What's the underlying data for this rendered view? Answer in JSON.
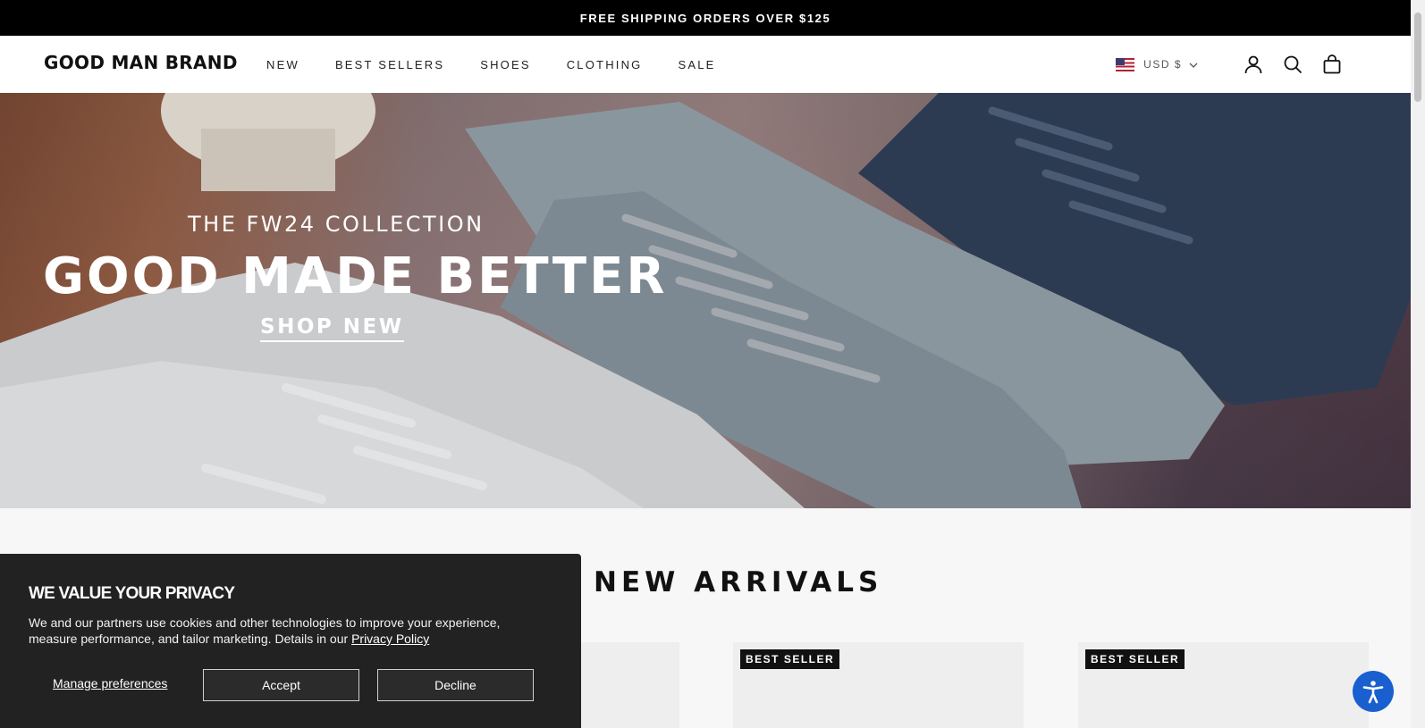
{
  "announcement": {
    "text": "FREE SHIPPING ORDERS OVER $125"
  },
  "header": {
    "logo": "GOOD MAN BRAND",
    "nav": [
      "NEW",
      "BEST SELLERS",
      "SHOES",
      "CLOTHING",
      "SALE"
    ],
    "currency": "USD $",
    "icons": [
      "account-icon",
      "search-icon",
      "cart-icon"
    ]
  },
  "hero": {
    "eyebrow": "THE FW24 COLLECTION",
    "title": "GOOD MADE BETTER",
    "cta": "SHOP NEW"
  },
  "section": {
    "title": "NEW ARRIVALS"
  },
  "products": [
    {
      "badge": ""
    },
    {
      "badge": "BEST SELLER"
    },
    {
      "badge": "BEST SELLER"
    }
  ],
  "privacy": {
    "title": "WE VALUE YOUR PRIVACY",
    "body": "We and our partners use cookies and other technologies to improve your experience, measure performance, and tailor marketing. Details in our",
    "link": "Privacy Policy",
    "manage": "Manage preferences",
    "accept": "Accept",
    "decline": "Decline"
  },
  "colors": {
    "announcement_bg": "#000000",
    "privacy_bg": "#222222",
    "accessibility_button": "#1a5fd0"
  }
}
